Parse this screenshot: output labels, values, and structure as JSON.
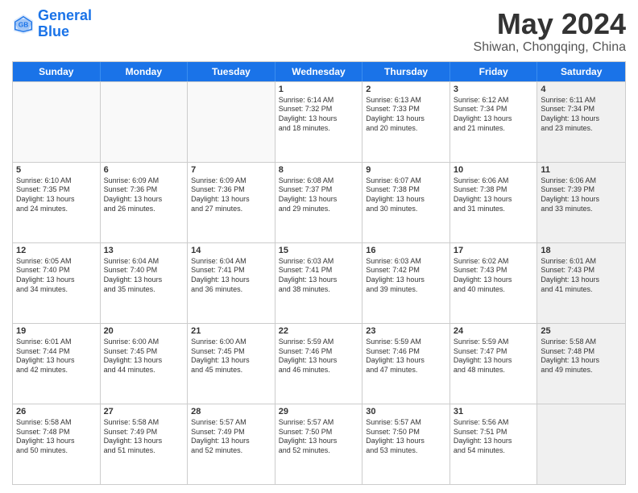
{
  "logo": {
    "line1": "General",
    "line2": "Blue"
  },
  "title": "May 2024",
  "subtitle": "Shiwan, Chongqing, China",
  "weekdays": [
    "Sunday",
    "Monday",
    "Tuesday",
    "Wednesday",
    "Thursday",
    "Friday",
    "Saturday"
  ],
  "weeks": [
    [
      {
        "day": "",
        "info": "",
        "empty": true
      },
      {
        "day": "",
        "info": "",
        "empty": true
      },
      {
        "day": "",
        "info": "",
        "empty": true
      },
      {
        "day": "1",
        "info": "Sunrise: 6:14 AM\nSunset: 7:32 PM\nDaylight: 13 hours\nand 18 minutes."
      },
      {
        "day": "2",
        "info": "Sunrise: 6:13 AM\nSunset: 7:33 PM\nDaylight: 13 hours\nand 20 minutes."
      },
      {
        "day": "3",
        "info": "Sunrise: 6:12 AM\nSunset: 7:34 PM\nDaylight: 13 hours\nand 21 minutes."
      },
      {
        "day": "4",
        "info": "Sunrise: 6:11 AM\nSunset: 7:34 PM\nDaylight: 13 hours\nand 23 minutes.",
        "shaded": true
      }
    ],
    [
      {
        "day": "5",
        "info": "Sunrise: 6:10 AM\nSunset: 7:35 PM\nDaylight: 13 hours\nand 24 minutes."
      },
      {
        "day": "6",
        "info": "Sunrise: 6:09 AM\nSunset: 7:36 PM\nDaylight: 13 hours\nand 26 minutes."
      },
      {
        "day": "7",
        "info": "Sunrise: 6:09 AM\nSunset: 7:36 PM\nDaylight: 13 hours\nand 27 minutes."
      },
      {
        "day": "8",
        "info": "Sunrise: 6:08 AM\nSunset: 7:37 PM\nDaylight: 13 hours\nand 29 minutes."
      },
      {
        "day": "9",
        "info": "Sunrise: 6:07 AM\nSunset: 7:38 PM\nDaylight: 13 hours\nand 30 minutes."
      },
      {
        "day": "10",
        "info": "Sunrise: 6:06 AM\nSunset: 7:38 PM\nDaylight: 13 hours\nand 31 minutes."
      },
      {
        "day": "11",
        "info": "Sunrise: 6:06 AM\nSunset: 7:39 PM\nDaylight: 13 hours\nand 33 minutes.",
        "shaded": true
      }
    ],
    [
      {
        "day": "12",
        "info": "Sunrise: 6:05 AM\nSunset: 7:40 PM\nDaylight: 13 hours\nand 34 minutes."
      },
      {
        "day": "13",
        "info": "Sunrise: 6:04 AM\nSunset: 7:40 PM\nDaylight: 13 hours\nand 35 minutes."
      },
      {
        "day": "14",
        "info": "Sunrise: 6:04 AM\nSunset: 7:41 PM\nDaylight: 13 hours\nand 36 minutes."
      },
      {
        "day": "15",
        "info": "Sunrise: 6:03 AM\nSunset: 7:41 PM\nDaylight: 13 hours\nand 38 minutes."
      },
      {
        "day": "16",
        "info": "Sunrise: 6:03 AM\nSunset: 7:42 PM\nDaylight: 13 hours\nand 39 minutes."
      },
      {
        "day": "17",
        "info": "Sunrise: 6:02 AM\nSunset: 7:43 PM\nDaylight: 13 hours\nand 40 minutes."
      },
      {
        "day": "18",
        "info": "Sunrise: 6:01 AM\nSunset: 7:43 PM\nDaylight: 13 hours\nand 41 minutes.",
        "shaded": true
      }
    ],
    [
      {
        "day": "19",
        "info": "Sunrise: 6:01 AM\nSunset: 7:44 PM\nDaylight: 13 hours\nand 42 minutes."
      },
      {
        "day": "20",
        "info": "Sunrise: 6:00 AM\nSunset: 7:45 PM\nDaylight: 13 hours\nand 44 minutes."
      },
      {
        "day": "21",
        "info": "Sunrise: 6:00 AM\nSunset: 7:45 PM\nDaylight: 13 hours\nand 45 minutes."
      },
      {
        "day": "22",
        "info": "Sunrise: 5:59 AM\nSunset: 7:46 PM\nDaylight: 13 hours\nand 46 minutes."
      },
      {
        "day": "23",
        "info": "Sunrise: 5:59 AM\nSunset: 7:46 PM\nDaylight: 13 hours\nand 47 minutes."
      },
      {
        "day": "24",
        "info": "Sunrise: 5:59 AM\nSunset: 7:47 PM\nDaylight: 13 hours\nand 48 minutes."
      },
      {
        "day": "25",
        "info": "Sunrise: 5:58 AM\nSunset: 7:48 PM\nDaylight: 13 hours\nand 49 minutes.",
        "shaded": true
      }
    ],
    [
      {
        "day": "26",
        "info": "Sunrise: 5:58 AM\nSunset: 7:48 PM\nDaylight: 13 hours\nand 50 minutes."
      },
      {
        "day": "27",
        "info": "Sunrise: 5:58 AM\nSunset: 7:49 PM\nDaylight: 13 hours\nand 51 minutes."
      },
      {
        "day": "28",
        "info": "Sunrise: 5:57 AM\nSunset: 7:49 PM\nDaylight: 13 hours\nand 52 minutes."
      },
      {
        "day": "29",
        "info": "Sunrise: 5:57 AM\nSunset: 7:50 PM\nDaylight: 13 hours\nand 52 minutes."
      },
      {
        "day": "30",
        "info": "Sunrise: 5:57 AM\nSunset: 7:50 PM\nDaylight: 13 hours\nand 53 minutes."
      },
      {
        "day": "31",
        "info": "Sunrise: 5:56 AM\nSunset: 7:51 PM\nDaylight: 13 hours\nand 54 minutes."
      },
      {
        "day": "",
        "info": "",
        "empty": true,
        "shaded": true
      }
    ]
  ]
}
